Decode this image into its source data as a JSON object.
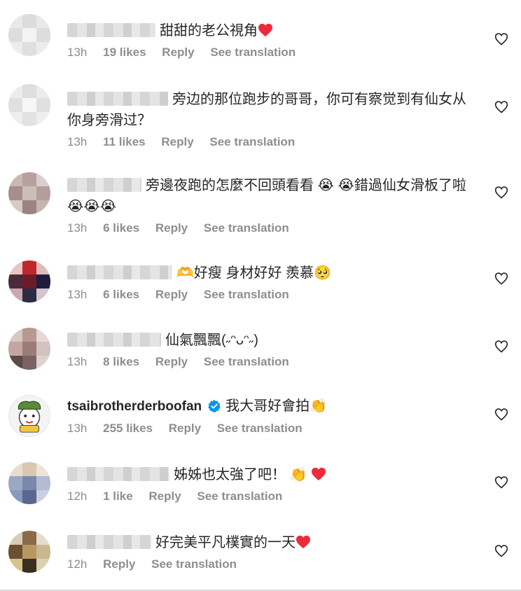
{
  "comments": [
    {
      "text": "甜甜的老公視角",
      "time": "13h",
      "likes": "19 likes",
      "reply": "Reply",
      "translate": "See translation"
    },
    {
      "text": "旁边的那位跑步的哥哥，你可有察觉到有仙女从你身旁滑过？",
      "time": "13h",
      "likes": "11 likes",
      "reply": "Reply",
      "translate": "See translation"
    },
    {
      "text": "旁邊夜跑的怎麼不回頭看看",
      "text2": "錯過仙女滑板了啦",
      "time": "13h",
      "likes": "6 likes",
      "reply": "Reply",
      "translate": "See translation"
    },
    {
      "text": "好瘦 身材好好 羨慕",
      "time": "13h",
      "likes": "6 likes",
      "reply": "Reply",
      "translate": "See translation"
    },
    {
      "text": "仙氣飄飄(˶ᵔᴗᵔ˶)",
      "time": "13h",
      "likes": "8 likes",
      "reply": "Reply",
      "translate": "See translation"
    },
    {
      "username": "tsaibrotherderboofan",
      "text": "我大哥好會拍",
      "time": "13h",
      "likes": "255 likes",
      "reply": "Reply",
      "translate": "See translation"
    },
    {
      "text": "姊姊也太強了吧！",
      "time": "12h",
      "likes": "1 like",
      "reply": "Reply",
      "translate": "See translation"
    },
    {
      "text": "好完美平凡樸實的一天",
      "time": "12h",
      "reply": "Reply",
      "translate": "See translation"
    }
  ],
  "emoji": {
    "cry": "😭",
    "hands": "🫶",
    "pleading": "🥺",
    "clap": "👏"
  },
  "icons": {
    "like": "heart-outline-icon",
    "verified": "verified-badge-icon",
    "red_heart": "red-heart-icon"
  },
  "colors": {
    "text": "#262626",
    "meta": "#8e8e8e",
    "verified": "#0095f6",
    "heart": "#ed4956"
  }
}
